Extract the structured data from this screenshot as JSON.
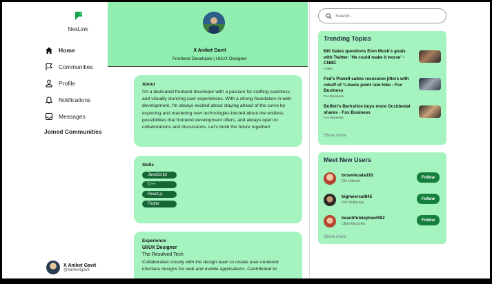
{
  "app": {
    "name": "NexLink"
  },
  "nav": [
    {
      "label": "Home",
      "icon": "home-icon",
      "active": true
    },
    {
      "label": "Communities",
      "icon": "flag-icon",
      "active": false
    },
    {
      "label": "Profile",
      "icon": "user-icon",
      "active": false
    },
    {
      "label": "Notifications",
      "icon": "bell-icon",
      "active": false
    },
    {
      "label": "Messages",
      "icon": "inbox-icon",
      "active": false
    }
  ],
  "sidebar": {
    "joined_title": "Joined Communities"
  },
  "current_user": {
    "name": "X Aniket Gavit",
    "handle": "@xaniketgavit",
    "menu": "…"
  },
  "profile": {
    "name": "X Aniket Gavit",
    "title": "Frontend Developer | UI/UX Designer"
  },
  "about": {
    "title": "About",
    "text": "I'm a dedicated frontend developer with a passion for crafting seamless and visually stunning user experiences. With a strong foundation in web development, I'm always excited about staying ahead of the curve by exploring and mastering new technologies.bected about the endless possibilities that frontend development offers, and always open to collaborations and discussions. Let's build the future together!"
  },
  "skills": {
    "title": "Skills",
    "items": [
      "JavaScript",
      "C++",
      "React.js",
      "Flutter"
    ]
  },
  "experience": {
    "title": "Experience",
    "role": "UI/UX Designer",
    "company": "The Resolved Tech",
    "text": "Collaborated closely with the design team to create user-centered interface designs for web and mobile applications. Contributed to"
  },
  "search": {
    "placeholder": "Search.."
  },
  "trending": {
    "title": "Trending Topics",
    "more": "Show more",
    "items": [
      {
        "title": "Bill Gates questions Elon Musk's goals with Twitter: 'He could make it worse' - CNBC",
        "source": "CNBC"
      },
      {
        "title": "Fed's Powell calms recession jitters with rebuff of ¾-basis point rate hike - Fox Business",
        "source": "Fox Business"
      },
      {
        "title": "Buffett's Berkshire buys more Occidental shares - Fox Business",
        "source": "Fox Business"
      }
    ]
  },
  "new_users": {
    "title": "Meet New Users",
    "more": "Show more",
    "follow_label": "Follow",
    "items": [
      {
        "username": "brownkoala316",
        "real_name": "Ole Lillestel"
      },
      {
        "username": "bigmeercat845",
        "real_name": "Filo McIlwraig"
      },
      {
        "username": "beautifulelephant592",
        "real_name": "Lillya Klyuchko"
      }
    ]
  },
  "colors": {
    "accent": "#90eeb0",
    "card": "#a5f3bf",
    "button": "#15803d",
    "skill_chip": "#166534"
  }
}
